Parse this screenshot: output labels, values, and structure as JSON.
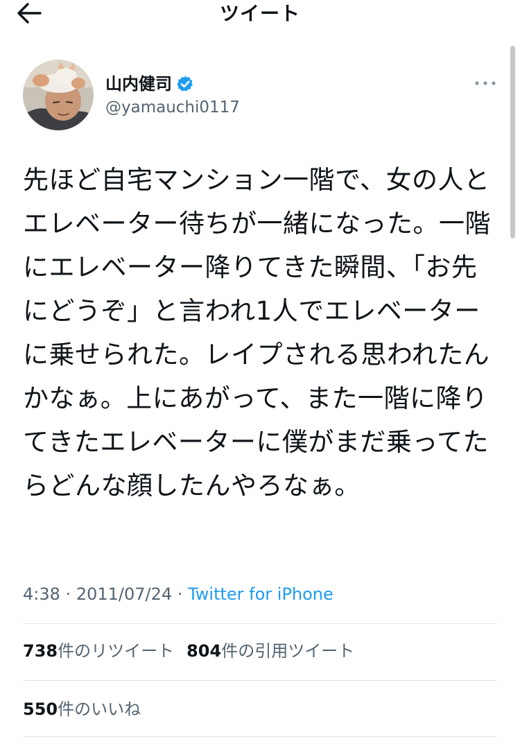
{
  "header": {
    "title": "ツイート",
    "back_icon": "arrow-left-icon"
  },
  "author": {
    "display_name": "山内健司",
    "handle": "@yamauchi0117",
    "verified": true,
    "verified_color": "#1d9bf0"
  },
  "tweet": {
    "text": "先ほど自宅マンション一階で、女の人とエレベーター待ちが一緒になった。一階にエレベーター降りてきた瞬間、「お先にどうぞ」と言われ1人でエレベーターに乗せられた。レイプされる思われたんかなぁ。上にあがって、また一階に降りてきたエレベーターに僕がまだ乗ってたらどんな顔したんやろなぁ。",
    "time": "4:38",
    "separator": "·",
    "date": "2011/07/24",
    "source": "Twitter for iPhone"
  },
  "stats": {
    "retweets_count": "738",
    "retweets_label": "件のリツイート",
    "quotes_count": "804",
    "quotes_label": "件の引用ツイート",
    "likes_count": "550",
    "likes_label": "件のいいね"
  },
  "colors": {
    "text": "#0f1419",
    "secondary": "#536471",
    "link": "#1d9bf0",
    "divider": "#dfe3e7"
  }
}
